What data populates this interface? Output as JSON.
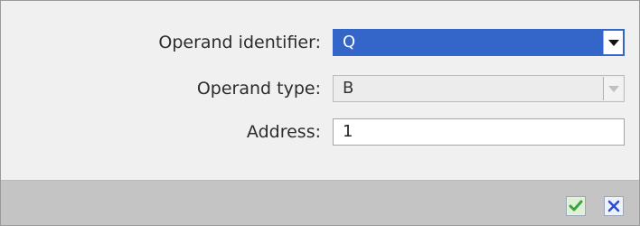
{
  "form": {
    "operand_identifier": {
      "label": "Operand identifier:",
      "value": "Q"
    },
    "operand_type": {
      "label": "Operand type:",
      "value": "B"
    },
    "address": {
      "label": "Address:",
      "value": "1"
    }
  },
  "footer": {
    "confirm_icon": "checkmark-icon",
    "cancel_icon": "close-icon"
  },
  "colors": {
    "selected_field_bg": "#3465c8",
    "footer_bg": "#c4c4c4",
    "confirm_green": "#3aa53a",
    "cancel_blue": "#2a4fd0"
  }
}
